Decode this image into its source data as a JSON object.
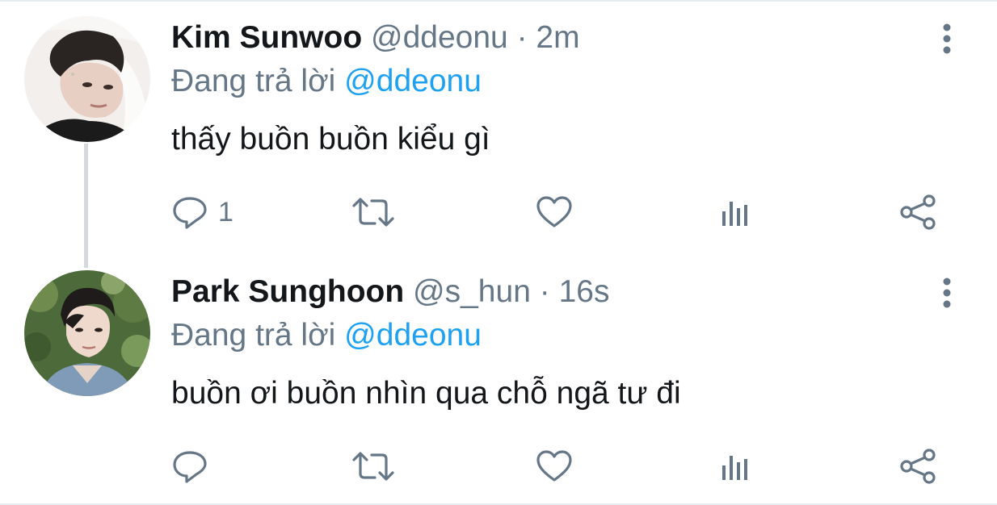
{
  "tweets": [
    {
      "display_name": "Kim Sunwoo",
      "handle": "@ddeonu",
      "separator": "·",
      "time": "2m",
      "reply_prefix": "Đang trả lời",
      "reply_to": "@ddeonu",
      "text": "thấy buồn buồn kiểu gì",
      "reply_count": "1",
      "icons": [
        "reply-icon",
        "retweet-icon",
        "like-icon",
        "stats-icon",
        "share-icon",
        "more-icon"
      ]
    },
    {
      "display_name": "Park Sunghoon",
      "handle": "@s_hun",
      "separator": "·",
      "time": "16s",
      "reply_prefix": "Đang trả lời",
      "reply_to": "@ddeonu",
      "text": "buồn ơi buồn nhìn qua chỗ ngã tư đi",
      "reply_count": "",
      "icons": [
        "reply-icon",
        "retweet-icon",
        "like-icon",
        "stats-icon",
        "share-icon",
        "more-icon"
      ]
    }
  ],
  "colors": {
    "text_primary": "#14171a",
    "text_secondary": "#657786",
    "accent": "#1da1f2",
    "thread_line": "#d4d9dd"
  }
}
